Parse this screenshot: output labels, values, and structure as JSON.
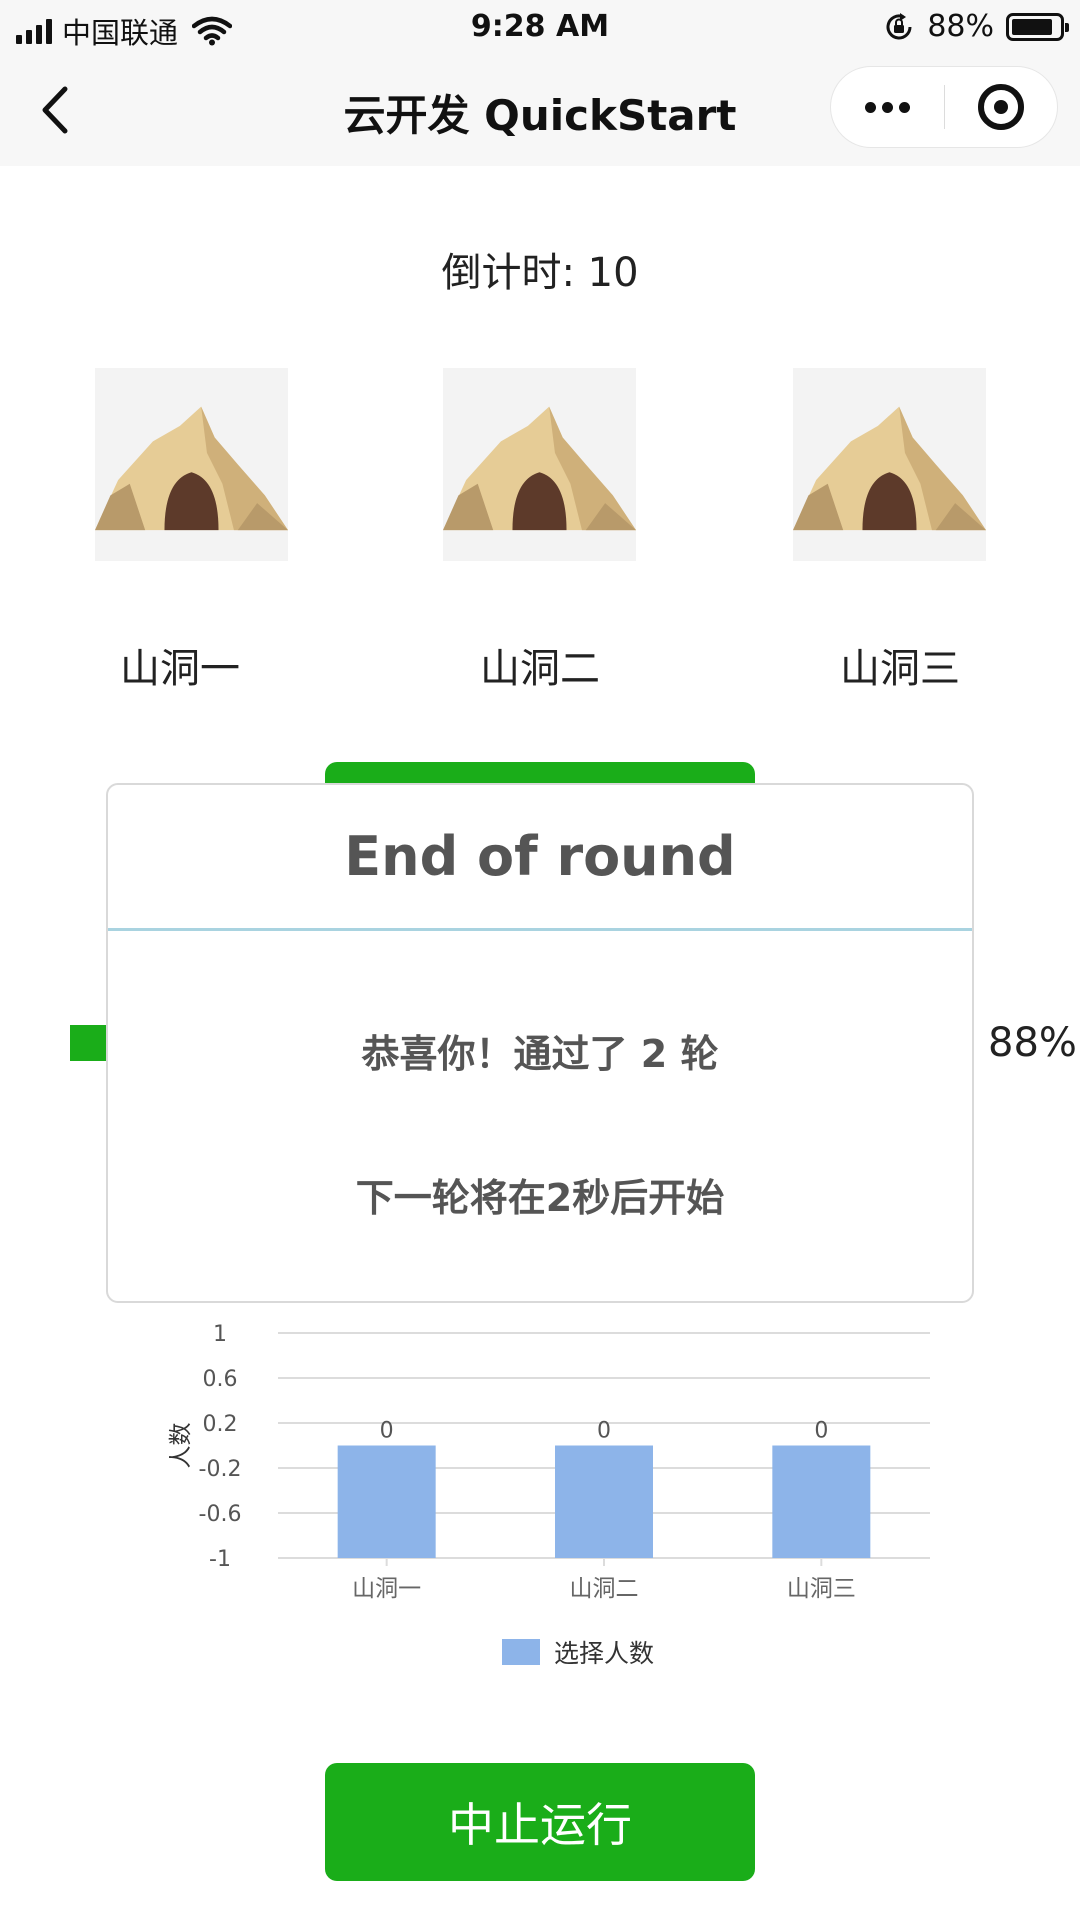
{
  "status_bar": {
    "carrier": "中国联通",
    "time": "9:28 AM",
    "battery_text": "88%",
    "battery_level": 0.88,
    "icons": [
      "signal-icon",
      "wifi-icon",
      "orientation-lock-icon",
      "battery-icon"
    ]
  },
  "nav": {
    "title": "云开发 QuickStart",
    "icons": [
      "back-chevron-icon",
      "more-dots-icon",
      "target-circle-icon"
    ]
  },
  "countdown": "倒计时: 10",
  "caves": [
    {
      "label": "山洞一",
      "icon": "cave-icon"
    },
    {
      "label": "山洞二",
      "icon": "cave-icon"
    },
    {
      "label": "山洞三",
      "icon": "cave-icon"
    }
  ],
  "progress_text": "88%",
  "modal": {
    "title": "End of round",
    "line1": "恭喜你！通过了 2 轮",
    "line2": "下一轮将在2秒后开始"
  },
  "chart_data": {
    "type": "bar",
    "categories": [
      "山洞一",
      "山洞二",
      "山洞三"
    ],
    "series": [
      {
        "name": "选择人数",
        "values": [
          0,
          0,
          0
        ],
        "color": "#8db4e9"
      }
    ],
    "data_labels": [
      "0",
      "0",
      "0"
    ],
    "ylabel": "人数",
    "y_ticks": [
      "1",
      "0.6",
      "0.2",
      "-0.2",
      "-0.6",
      "-1"
    ],
    "ylim": [
      -1,
      1
    ],
    "grid": true,
    "legend_position": "bottom"
  },
  "stop_button": {
    "label": "中止运行",
    "color": "#1aad19"
  }
}
